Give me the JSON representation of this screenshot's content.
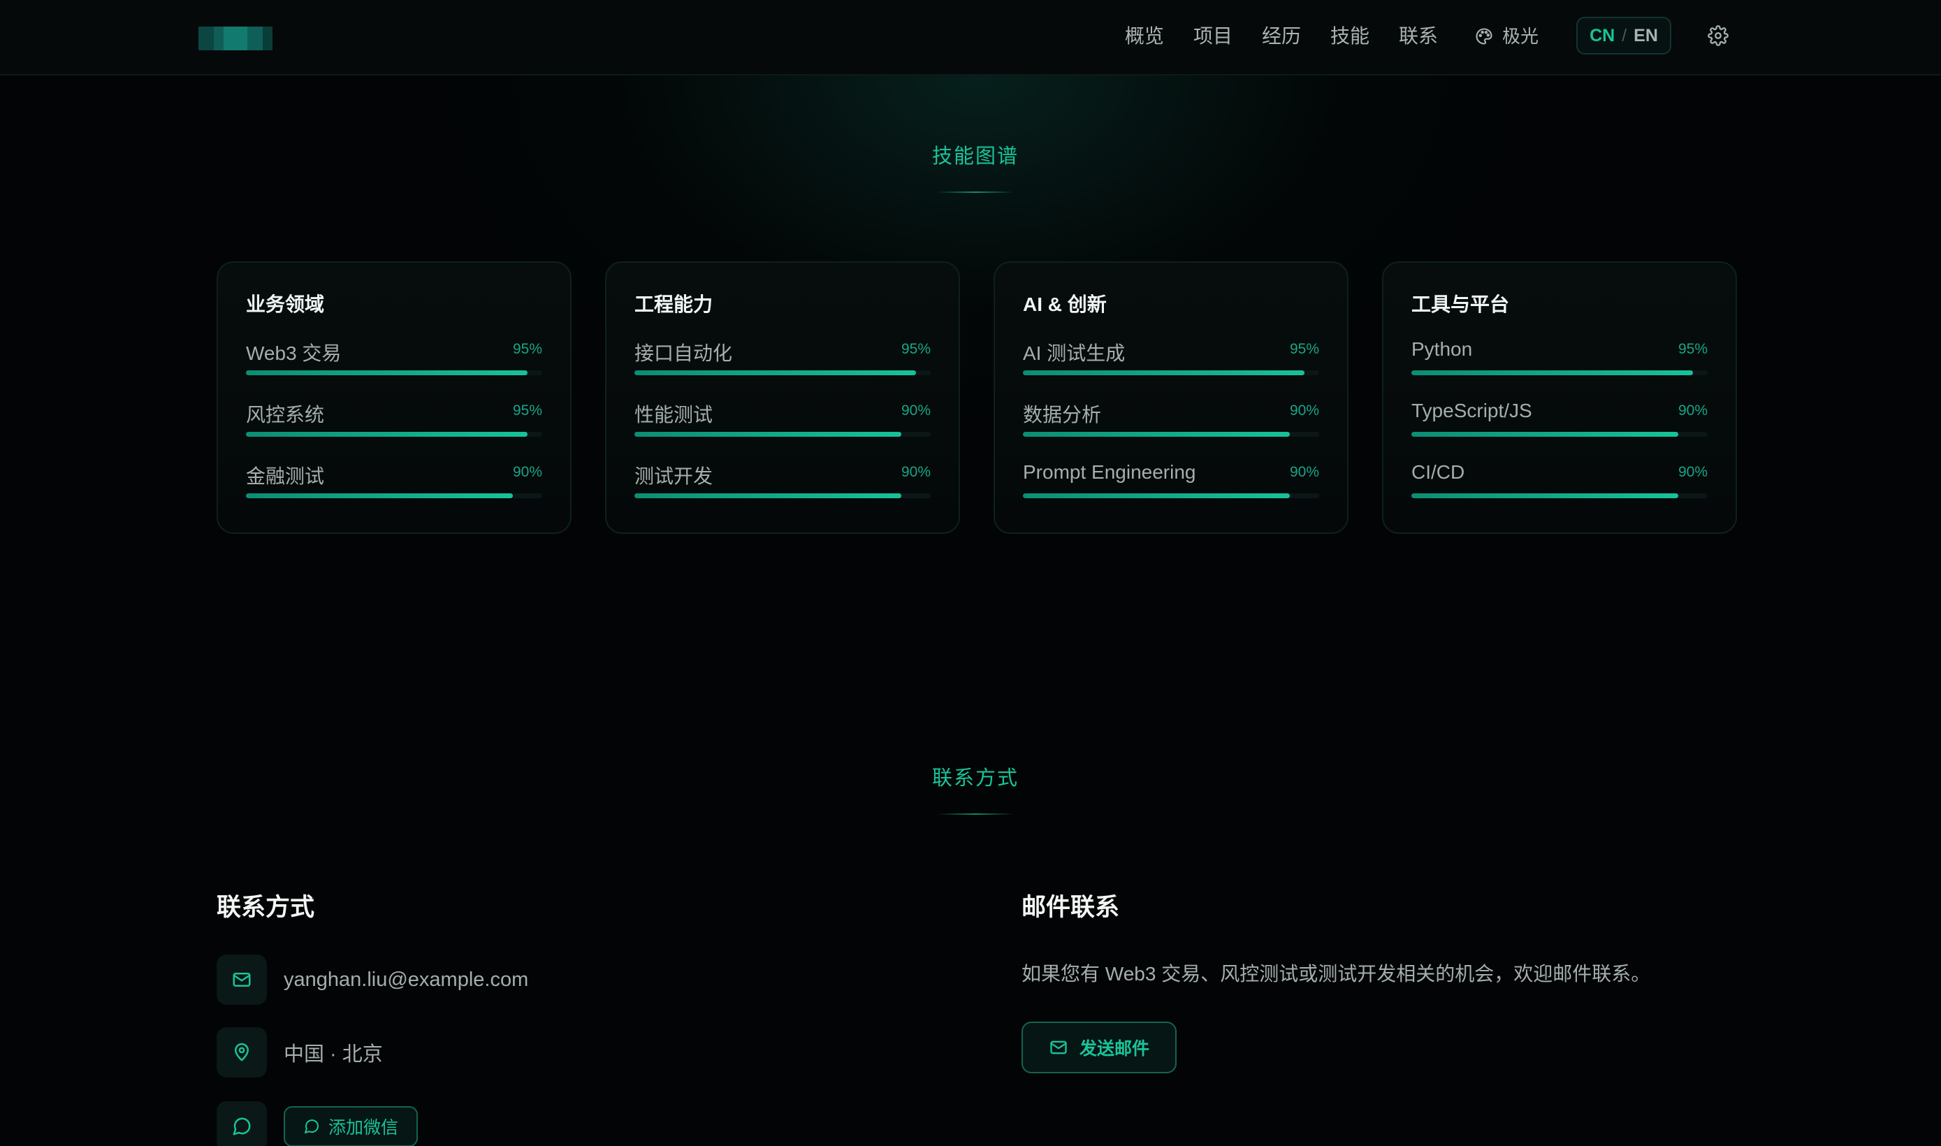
{
  "header": {
    "nav": [
      "概览",
      "项目",
      "经历",
      "技能",
      "联系"
    ],
    "theme_label": "极光",
    "lang": {
      "cn": "CN",
      "sep": "/",
      "en": "EN"
    }
  },
  "skills_section": {
    "title": "技能图谱",
    "cards": [
      {
        "title": "业务领域",
        "skills": [
          {
            "name": "Web3 交易",
            "pct_label": "95%",
            "level": 0.95
          },
          {
            "name": "风控系统",
            "pct_label": "95%",
            "level": 0.95
          },
          {
            "name": "金融测试",
            "pct_label": "90%",
            "level": 0.9
          }
        ]
      },
      {
        "title": "工程能力",
        "skills": [
          {
            "name": "接口自动化",
            "pct_label": "95%",
            "level": 0.95
          },
          {
            "name": "性能测试",
            "pct_label": "90%",
            "level": 0.9
          },
          {
            "name": "测试开发",
            "pct_label": "90%",
            "level": 0.9
          }
        ]
      },
      {
        "title": "AI & 创新",
        "skills": [
          {
            "name": "AI 测试生成",
            "pct_label": "95%",
            "level": 0.95
          },
          {
            "name": "数据分析",
            "pct_label": "90%",
            "level": 0.9
          },
          {
            "name": "Prompt Engineering",
            "pct_label": "90%",
            "level": 0.9
          }
        ]
      },
      {
        "title": "工具与平台",
        "skills": [
          {
            "name": "Python",
            "pct_label": "95%",
            "level": 0.95
          },
          {
            "name": "TypeScript/JS",
            "pct_label": "90%",
            "level": 0.9
          },
          {
            "name": "CI/CD",
            "pct_label": "90%",
            "level": 0.9
          }
        ]
      }
    ]
  },
  "contact_section": {
    "title": "联系方式",
    "left_heading": "联系方式",
    "email": "yanghan.liu@example.com",
    "location": "中国 · 北京",
    "wechat_button": "添加微信",
    "right_heading": "邮件联系",
    "mail_description": "如果您有 Web3 交易、风控测试或测试开发相关的机会，欢迎邮件联系。",
    "mail_button": "发送邮件"
  },
  "colors": {
    "accent": "#19c39a",
    "background": "#020405",
    "card_border": "#0f1f1d"
  },
  "icons": [
    "palette-icon",
    "gear-icon",
    "mail-icon",
    "location-pin-icon",
    "chat-bubble-icon"
  ]
}
